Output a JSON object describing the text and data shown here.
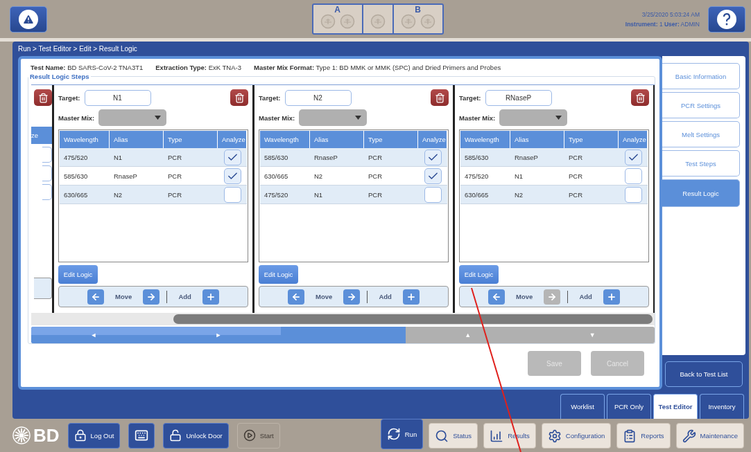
{
  "header": {
    "modules": [
      {
        "label": "A",
        "kind": "pair"
      },
      {
        "kind": "single"
      },
      {
        "label": "B",
        "kind": "pair"
      }
    ],
    "datetime": "3/25/2020 5:03:24 AM",
    "instrument_line": "**Instrument:** 1  **User:** ADMIN"
  },
  "breadcrumb": "Run > Test Editor > Edit > Result Logic",
  "test_info": [
    "**Test Name:** BD SARS-CoV-2 TNA3T1",
    "**Extraction Type:** ExK TNA-3",
    "**Master Mix Format:** Type 1:  BD MMK or MMK (SPC) and Dried Primers and Probes"
  ],
  "section_title": "Result Logic Steps",
  "partial_step": {
    "column_header": "ze",
    "checkboxes": [
      {
        "checked": false
      },
      {
        "checked": false
      },
      {
        "checked": false
      }
    ]
  },
  "steps": [
    {
      "target_label": "Target:",
      "target": "N1",
      "master_mix_label": "Master Mix:",
      "columns": [
        "Wavelength",
        "Alias",
        "Type",
        "Analyze"
      ],
      "rows": [
        {
          "wavelength": "475/520",
          "alias": "N1",
          "type": "PCR",
          "analyze": true
        },
        {
          "wavelength": "585/630",
          "alias": "RnaseP",
          "type": "PCR",
          "analyze": true
        },
        {
          "wavelength": "630/665",
          "alias": "N2",
          "type": "PCR",
          "analyze": false
        }
      ],
      "edit_logic": "Edit Logic",
      "move": "Move",
      "add": "Add",
      "move_right_disabled": false
    },
    {
      "target_label": "Target:",
      "target": "N2",
      "master_mix_label": "Master Mix:",
      "columns": [
        "Wavelength",
        "Alias",
        "Type",
        "Analyze"
      ],
      "rows": [
        {
          "wavelength": "585/630",
          "alias": "RnaseP",
          "type": "PCR",
          "analyze": true
        },
        {
          "wavelength": "630/665",
          "alias": "N2",
          "type": "PCR",
          "analyze": true
        },
        {
          "wavelength": "475/520",
          "alias": "N1",
          "type": "PCR",
          "analyze": false
        }
      ],
      "edit_logic": "Edit Logic",
      "move": "Move",
      "add": "Add",
      "move_right_disabled": false
    },
    {
      "target_label": "Target:",
      "target": "RNaseP",
      "master_mix_label": "Master Mix:",
      "columns": [
        "Wavelength",
        "Alias",
        "Type",
        "Analyze"
      ],
      "rows": [
        {
          "wavelength": "585/630",
          "alias": "RnaseP",
          "type": "PCR",
          "analyze": true
        },
        {
          "wavelength": "475/520",
          "alias": "N1",
          "type": "PCR",
          "analyze": false
        },
        {
          "wavelength": "630/665",
          "alias": "N2",
          "type": "PCR",
          "analyze": false
        }
      ],
      "edit_logic": "Edit Logic",
      "move": "Move",
      "add": "Add",
      "move_right_disabled": true
    }
  ],
  "scroll_nav": [
    "◄",
    "►",
    "▲",
    "▼"
  ],
  "buttons": [
    {
      "label": "Save",
      "disabled": true
    },
    {
      "label": "Cancel",
      "disabled": true
    }
  ],
  "side_tabs": [
    {
      "label": "Basic Information",
      "selected": false
    },
    {
      "label": "PCR Settings",
      "selected": false
    },
    {
      "label": "Melt Settings",
      "selected": false
    },
    {
      "label": "Test Steps",
      "selected": false
    },
    {
      "label": "Result Logic",
      "selected": true
    }
  ],
  "back_button": "Back to Test List",
  "mode_tabs": [
    {
      "label": "Worklist",
      "selected": false
    },
    {
      "label": "PCR Only",
      "selected": false
    },
    {
      "label": "Test Editor",
      "selected": true
    },
    {
      "label": "Inventory",
      "selected": false
    }
  ],
  "footer": {
    "logo": "BD",
    "left_buttons": [
      {
        "kind": "logout",
        "label": "Log Out",
        "disabled": false
      },
      {
        "kind": "keyboard",
        "disabled": false
      },
      {
        "kind": "unlock",
        "label": "Unlock Door",
        "disabled": false
      },
      {
        "kind": "start",
        "label": "Start",
        "disabled": true
      }
    ],
    "nav": [
      {
        "kind": "run",
        "label": "Run",
        "selected": true
      },
      {
        "kind": "status",
        "label": "Status",
        "selected": false
      },
      {
        "kind": "results",
        "label": "Results",
        "selected": false
      },
      {
        "kind": "configuration",
        "label": "Configuration",
        "selected": false
      },
      {
        "kind": "reports",
        "label": "Reports",
        "selected": false
      },
      {
        "kind": "maintenance",
        "label": "Maintenance",
        "selected": false
      }
    ]
  }
}
